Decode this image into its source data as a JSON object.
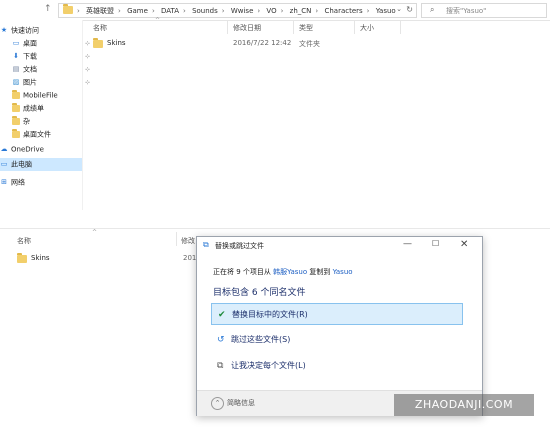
{
  "address": {
    "breadcrumbs": [
      "英雄联盟",
      "Game",
      "DATA",
      "Sounds",
      "Wwise",
      "VO",
      "zh_CN",
      "Characters",
      "Yasuo"
    ],
    "search_placeholder": "搜索\"Yasuo\""
  },
  "nav": {
    "quick_access": "快速访问",
    "items": [
      {
        "label": "桌面",
        "icon": "desktop-icon",
        "pinned": true
      },
      {
        "label": "下载",
        "icon": "download-icon",
        "pinned": true
      },
      {
        "label": "文档",
        "icon": "document-icon",
        "pinned": true
      },
      {
        "label": "图片",
        "icon": "picture-icon",
        "pinned": true
      },
      {
        "label": "MobileFile",
        "icon": "folder-icon",
        "pinned": false
      },
      {
        "label": "成绩单",
        "icon": "folder-icon",
        "pinned": false
      },
      {
        "label": "杂",
        "icon": "folder-icon",
        "pinned": false
      },
      {
        "label": "桌面文件",
        "icon": "folder-icon",
        "pinned": false
      }
    ],
    "onedrive": "OneDrive",
    "this_pc": "此电脑",
    "network": "网络"
  },
  "columns": {
    "name": "名称",
    "date": "修改日期",
    "type": "类型",
    "size": "大小"
  },
  "files": [
    {
      "name": "Skins",
      "date": "2016/7/22 12:42",
      "type": "文件夹"
    }
  ],
  "lower": {
    "col_name": "名称",
    "col_date": "修改",
    "file_name": "Skins",
    "date_partial": "201"
  },
  "dialog": {
    "title": "替换或跳过文件",
    "progress_prefix": "正在将 9 个项目从",
    "source": "韩服Yasuo",
    "progress_mid": "复制到",
    "dest": "Yasuo",
    "conflict": "目标包含 6 个同名文件",
    "options": [
      {
        "label": "替换目标中的文件(R)",
        "icon": "check-icon",
        "highlighted": true
      },
      {
        "label": "跳过这些文件(S)",
        "icon": "skip-icon",
        "highlighted": false
      },
      {
        "label": "让我决定每个文件(L)",
        "icon": "decide-icon",
        "highlighted": false
      }
    ],
    "more_info": "简略信息"
  },
  "watermark": "ZHAODANJI.COM"
}
